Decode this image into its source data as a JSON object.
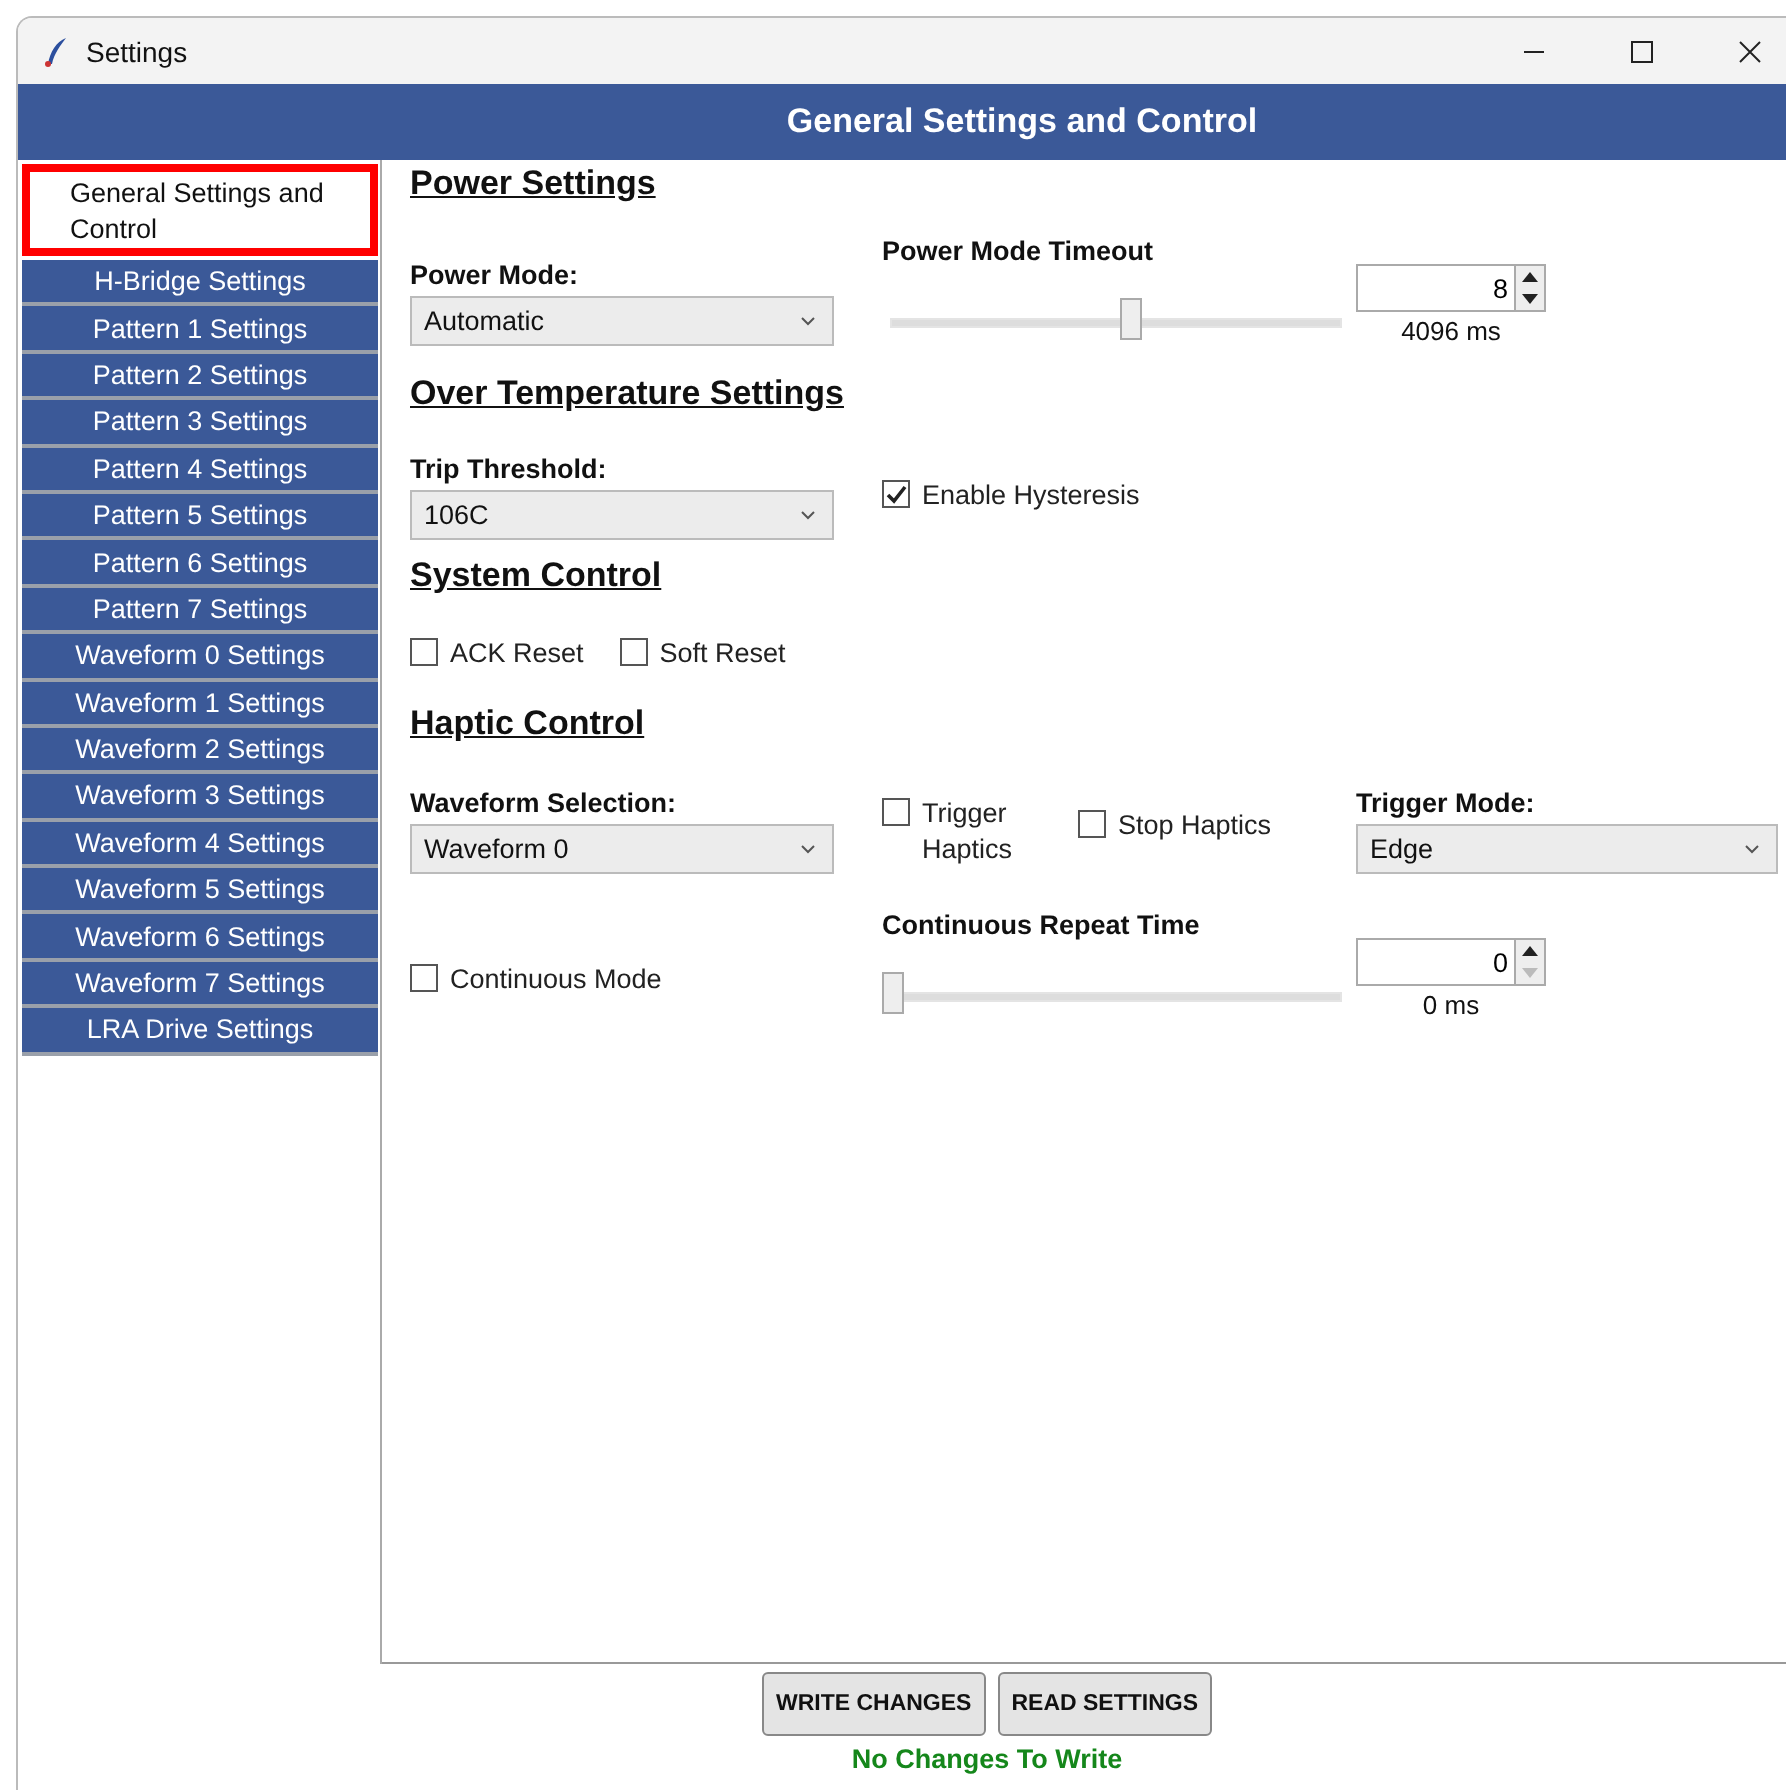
{
  "window": {
    "title": "Settings"
  },
  "header": "General Settings and Control",
  "sidebar": {
    "items": [
      {
        "label": "General Settings and Control",
        "selected": true
      },
      {
        "label": "H-Bridge Settings",
        "selected": false
      },
      {
        "label": "Pattern 1 Settings",
        "selected": false
      },
      {
        "label": "Pattern 2 Settings",
        "selected": false
      },
      {
        "label": "Pattern 3 Settings",
        "selected": false
      },
      {
        "label": "Pattern 4 Settings",
        "selected": false
      },
      {
        "label": "Pattern 5 Settings",
        "selected": false
      },
      {
        "label": "Pattern 6 Settings",
        "selected": false
      },
      {
        "label": "Pattern 7 Settings",
        "selected": false
      },
      {
        "label": "Waveform 0 Settings",
        "selected": false
      },
      {
        "label": "Waveform 1 Settings",
        "selected": false
      },
      {
        "label": "Waveform 2 Settings",
        "selected": false
      },
      {
        "label": "Waveform 3 Settings",
        "selected": false
      },
      {
        "label": "Waveform 4 Settings",
        "selected": false
      },
      {
        "label": "Waveform 5 Settings",
        "selected": false
      },
      {
        "label": "Waveform 6 Settings",
        "selected": false
      },
      {
        "label": "Waveform 7 Settings",
        "selected": false
      },
      {
        "label": "LRA Drive Settings",
        "selected": false
      }
    ]
  },
  "power_settings": {
    "heading": "Power Settings",
    "power_mode": {
      "label": "Power Mode:",
      "value": "Automatic"
    },
    "timeout": {
      "label": "Power Mode Timeout",
      "level": 0.54,
      "value": "8",
      "reading": "4096 ms"
    }
  },
  "over_temperature": {
    "heading": "Over Temperature Settings",
    "trip_threshold": {
      "label": "Trip Threshold:",
      "value": "106C"
    },
    "hysteresis": {
      "label": "Enable Hysteresis",
      "checked": true
    }
  },
  "system_control": {
    "heading": "System Control",
    "checkboxes": [
      {
        "label": "ACK Reset",
        "checked": false
      },
      {
        "label": "Soft Reset",
        "checked": false
      }
    ]
  },
  "haptic_control": {
    "heading": "Haptic Control",
    "waveform_selection": {
      "label": "Waveform Selection:",
      "value": "Waveform 0"
    },
    "trigger_haptics": {
      "label": "Trigger Haptics",
      "checked": false
    },
    "stop_haptics": {
      "label": "Stop Haptics",
      "checked": false
    },
    "trigger_mode": {
      "label": "Trigger Mode:",
      "value": "Edge"
    },
    "continuous_mode": {
      "label": "Continuous Mode",
      "checked": false
    },
    "repeat_time": {
      "label": "Continuous Repeat Time",
      "level": 0,
      "value": "0",
      "reading": "0 ms"
    }
  },
  "buttons": [
    "WRITE CHANGES",
    "READ SETTINGS"
  ],
  "status": "No Changes To Write"
}
